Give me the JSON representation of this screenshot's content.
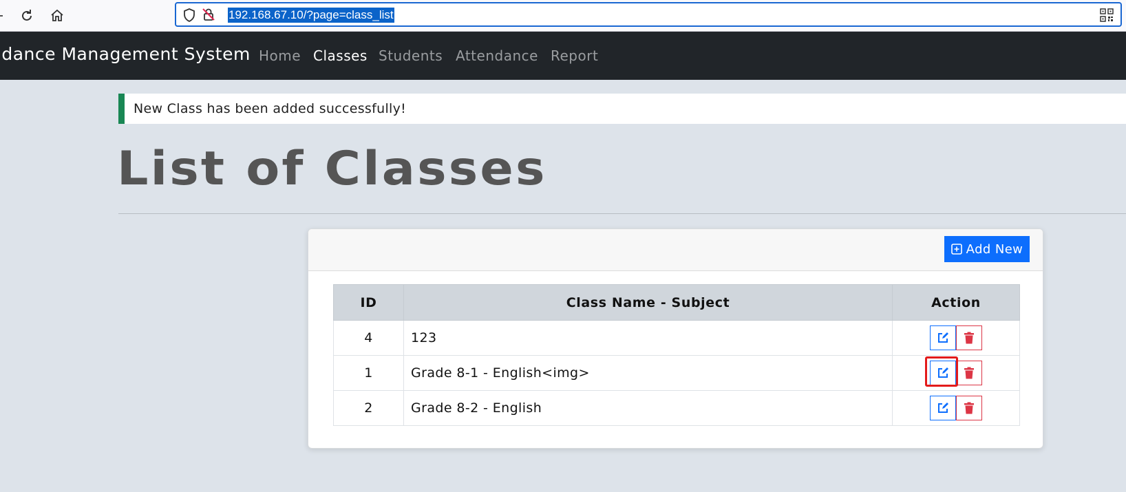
{
  "browser": {
    "url": "192.168.67.10/?page=class_list"
  },
  "navbar": {
    "brand": "ndance Management System",
    "links": [
      {
        "label": "Home",
        "active": false
      },
      {
        "label": "Classes",
        "active": true
      },
      {
        "label": "Students",
        "active": false
      },
      {
        "label": "Attendance",
        "active": false
      },
      {
        "label": "Report",
        "active": false
      }
    ]
  },
  "alert": {
    "message": "New Class has been added successfully!",
    "color": "#198754"
  },
  "page": {
    "title": "List of Classes"
  },
  "card": {
    "add_button_label": "Add New"
  },
  "table": {
    "headers": [
      "ID",
      "Class Name - Subject",
      "Action"
    ],
    "rows": [
      {
        "id": "4",
        "name": "123"
      },
      {
        "id": "1",
        "name": "Grade 8-1 - English<img>"
      },
      {
        "id": "2",
        "name": "Grade 8-2 - English"
      }
    ]
  },
  "colors": {
    "primary": "#0d6efd",
    "danger": "#dc3545",
    "navbar": "#212529",
    "highlight": "#e31b1b"
  },
  "icons": {
    "back": "arrow-left-icon",
    "reload": "reload-icon",
    "home": "home-icon",
    "shield": "shield-icon",
    "insecure": "insecure-lock-icon",
    "qr": "qr-code-icon",
    "add": "plus-square-icon",
    "edit": "edit-icon",
    "delete": "trash-icon"
  }
}
